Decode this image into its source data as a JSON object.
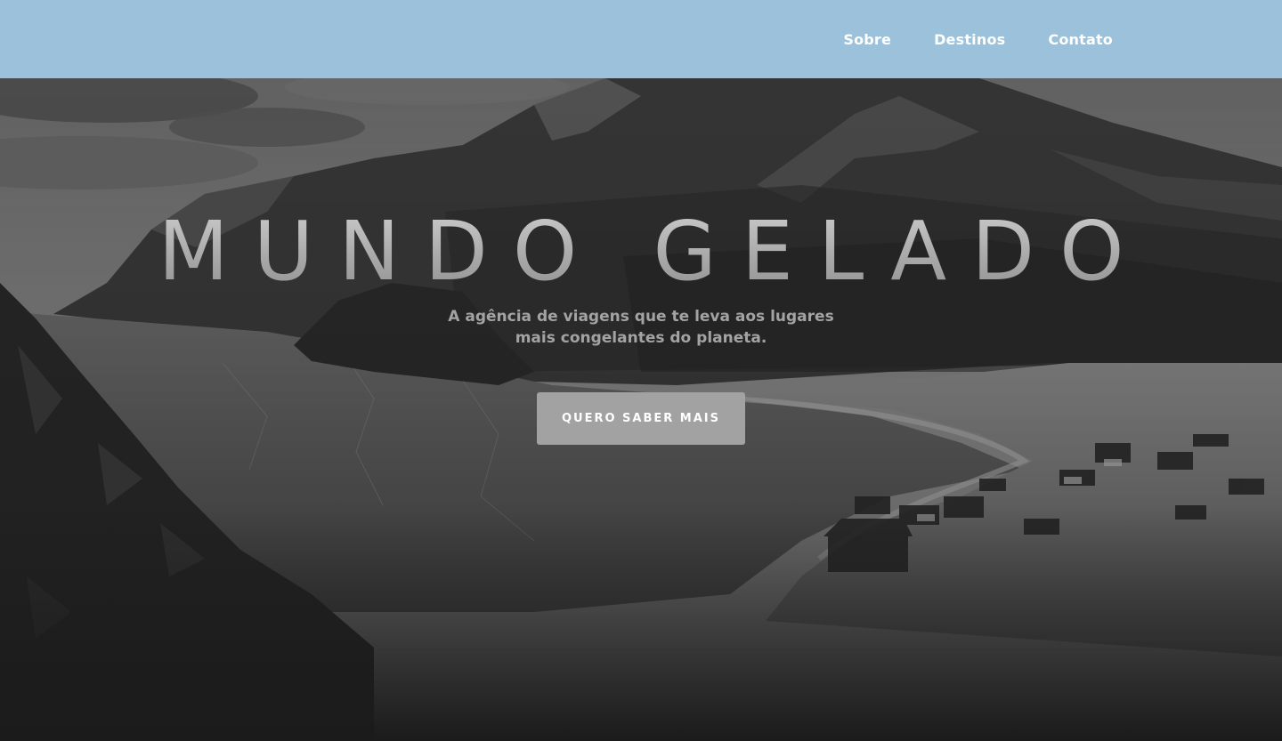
{
  "nav": {
    "links": [
      "Sobre",
      "Destinos",
      "Contato"
    ]
  },
  "hero": {
    "title": "MUNDO GELADO",
    "subtitle": "A agência de viagens que te leva aos lugares mais congelantes do planeta.",
    "cta_label": "QUERO SABER MAIS"
  },
  "colors": {
    "navbar_background": "#9bc1db",
    "nav_text": "#ffffff",
    "button_background": "#a2a2a2",
    "page_bottom": "#1b1b1c"
  }
}
